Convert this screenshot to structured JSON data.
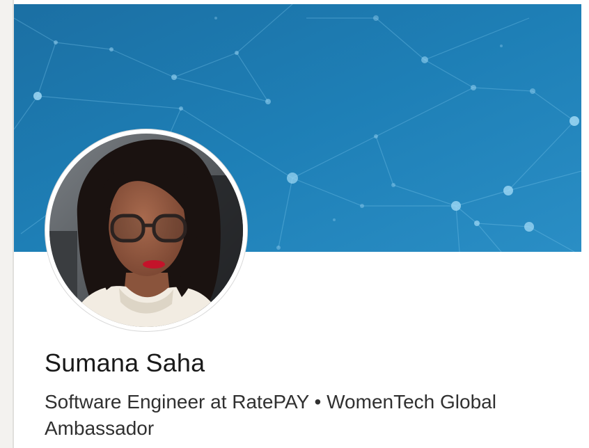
{
  "profile": {
    "name": "Sumana Saha",
    "headline": "Software Engineer at RatePAY • WomenTech Global Ambassador"
  },
  "banner": {
    "color_top": "#1b6fa3",
    "color_bottom": "#2a8ec5",
    "network_color": "#7ec8ef"
  },
  "avatar": {
    "border_color": "#ffffff"
  }
}
